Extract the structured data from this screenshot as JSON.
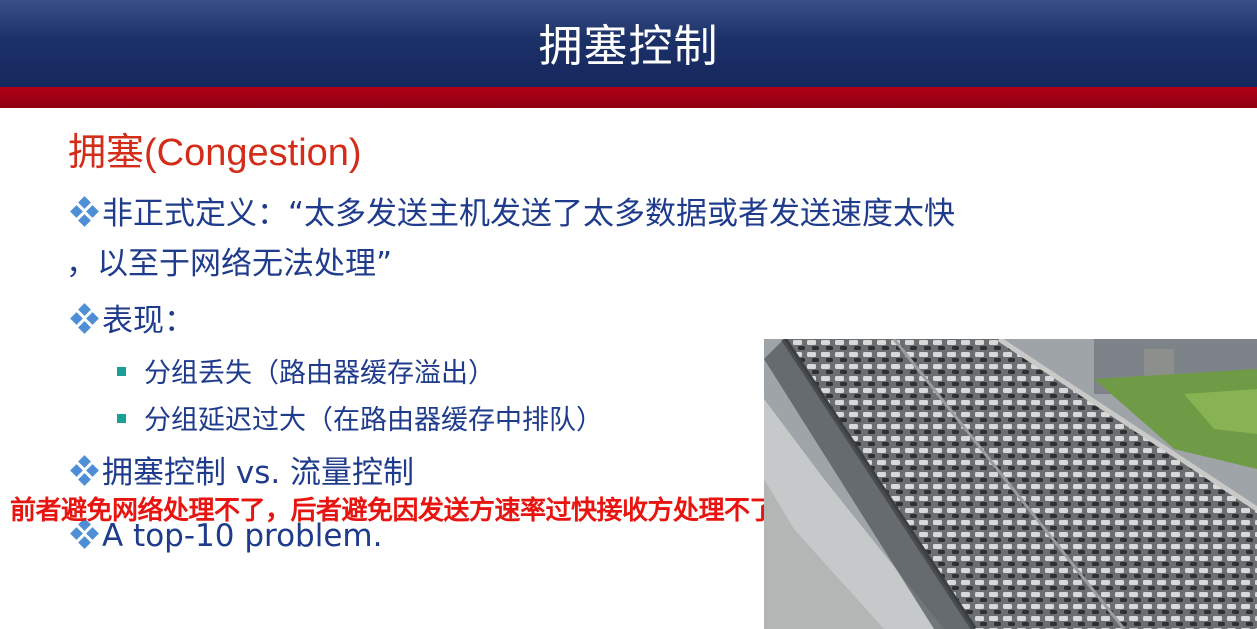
{
  "header": {
    "title": "拥塞控制"
  },
  "section": {
    "title": "拥塞(Congestion)"
  },
  "bullets": [
    {
      "line1": "非正式定义：“太多发送主机发送了太多数据或者发送速度太快",
      "line2": "，以至于网络无法处理”"
    },
    {
      "text": "表现："
    },
    {
      "text": "拥塞控制 vs. 流量控制"
    },
    {
      "text": "A top-10 problem."
    }
  ],
  "sub_bullets": [
    {
      "text": "分组丢失（路由器缓存溢出）"
    },
    {
      "text": "分组延迟过大（在路由器缓存中排队）"
    }
  ],
  "annotation": {
    "text": "前者避免网络处理不了，后者避免因发送方速率过快接收方处理不了"
  },
  "colors": {
    "header_blue": "#1d3169",
    "header_red": "#a00012",
    "title_red": "#d32c18",
    "text_blue": "#1f3b8c",
    "note_red": "#e8140f",
    "diamond": "#4d8ed6",
    "square": "#1aa094"
  },
  "image": {
    "subject": "traffic-jam-photo"
  }
}
